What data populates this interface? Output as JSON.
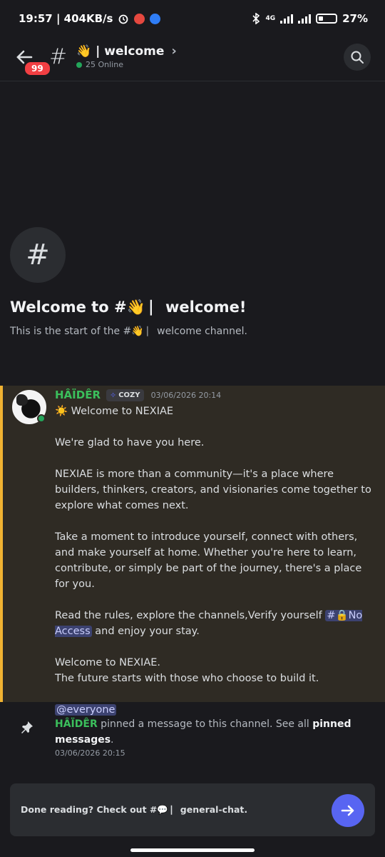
{
  "status_bar": {
    "time_speed": "19:57 | 404KB/s",
    "network": "4G",
    "battery": "27%",
    "battery_level": 0.27
  },
  "header": {
    "unread_count": "99",
    "hash": "#",
    "channel_emoji": "👋",
    "channel_name": "| welcome",
    "chevron": "›",
    "online": "25 Online"
  },
  "intro": {
    "hash": "#",
    "title": "Welcome to #👋 ⎸welcome!",
    "subtitle": "This is the start of the #👋 ⎸welcome channel."
  },
  "message": {
    "author": "HÂÏDÊR",
    "tag_icon": "✧",
    "tag": "COZY",
    "timestamp": "03/06/2026 20:14",
    "lines": {
      "l1": "☀️ Welcome to NEXIAE",
      "l2": "We're glad to have you here.",
      "l3": "NEXIAE is more than a community—it's a place where builders, thinkers, creators, and visionaries come together to explore what comes next.",
      "l4": "Take a moment to introduce yourself, connect with others, and make yourself at home. Whether you're here to learn, contribute, or simply be part of the journey, there's a place for you.",
      "l5_pre": "Read the rules, explore the channels,Verify yourself ",
      "l5_mention": "#🔒No Access",
      "l5_post": " and enjoy your stay.",
      "l6": "Welcome to NEXIAE.",
      "l7": "The future starts with those who choose to build it.",
      "everyone": "@everyone"
    }
  },
  "system": {
    "author": "HÂÏDÊR",
    "text": " pinned a message to this channel. See all ",
    "link": "pinned messages",
    "end": ".",
    "timestamp": "03/06/2026 20:15"
  },
  "footer": {
    "text": "Done reading? Check out #💬 ⎸general-chat."
  }
}
